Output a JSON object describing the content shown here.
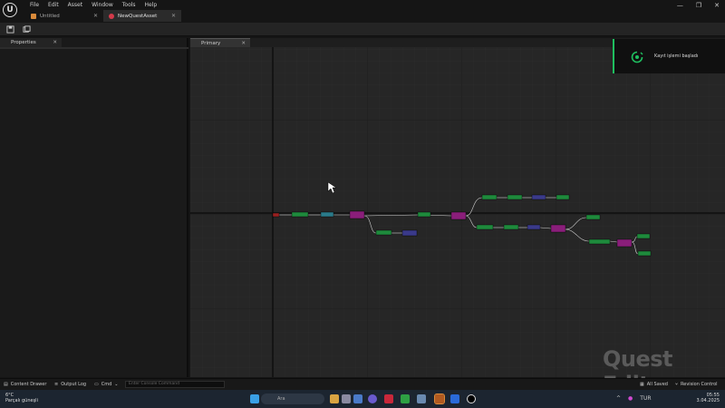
{
  "menu": [
    "File",
    "Edit",
    "Asset",
    "Window",
    "Tools",
    "Help"
  ],
  "tabs": [
    {
      "label": "Untitled",
      "color": "#d98a3a"
    },
    {
      "label": "NewQuestAsset",
      "color": "#d43a4a"
    }
  ],
  "window_controls": {
    "minimize": "—",
    "maximize": "❐",
    "close": "✕"
  },
  "panels": {
    "properties": "Properties",
    "primary": "Primary"
  },
  "notification": {
    "text": "Kayıt işlemi başladı",
    "color": "#1fbf5f"
  },
  "watermark": "Quest Editor",
  "statusbar": {
    "content_drawer": "Content Drawer",
    "output_log": "Output Log",
    "cmd": "Cmd",
    "cmd_placeholder": "Enter Console Command",
    "all_saved": "All Saved",
    "revision_control": "Revision Control"
  },
  "taskbar": {
    "weather_temp": "6°C",
    "weather_desc": "Parçalı güneşli",
    "search": "Ara",
    "lang": "TUR",
    "time": "05:55",
    "date": "3.04.2025"
  },
  "graph_nodes": {
    "colors": {
      "green": "#1e8a3c",
      "teal": "#2a7a8a",
      "magenta": "#8a1e7a",
      "purple": "#3a3a8a",
      "red": "#9a2020"
    }
  }
}
